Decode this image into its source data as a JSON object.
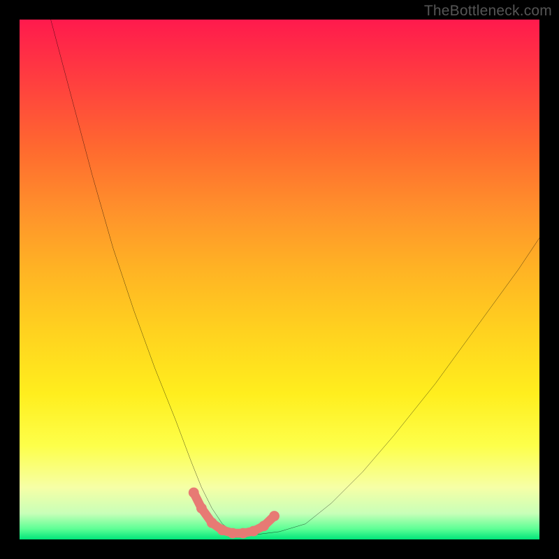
{
  "watermark": "TheBottleneck.com",
  "chart_data": {
    "type": "line",
    "title": "",
    "xlabel": "",
    "ylabel": "",
    "xlim": [
      0,
      100
    ],
    "ylim": [
      0,
      100
    ],
    "grid": false,
    "legend": false,
    "annotations": [],
    "background_gradient": {
      "orientation": "vertical",
      "stops": [
        {
          "pos": 0.0,
          "color": "#ff1a4d"
        },
        {
          "pos": 0.25,
          "color": "#ff6a2f"
        },
        {
          "pos": 0.5,
          "color": "#ffb324"
        },
        {
          "pos": 0.75,
          "color": "#ffee1e"
        },
        {
          "pos": 0.95,
          "color": "#c8ffb8"
        },
        {
          "pos": 1.0,
          "color": "#00e57a"
        }
      ]
    },
    "series": [
      {
        "name": "bottleneck-curve",
        "color": "#000000",
        "stroke_width": 2,
        "x": [
          6,
          10,
          14,
          18,
          22,
          26,
          30,
          33,
          35,
          37,
          39,
          41,
          43,
          46,
          50,
          55,
          60,
          66,
          72,
          80,
          88,
          96,
          100
        ],
        "y": [
          100,
          85,
          70,
          56,
          44,
          33,
          23,
          15,
          10,
          6,
          3,
          1.5,
          1,
          1,
          1.5,
          3,
          7,
          13,
          20,
          30,
          41,
          52,
          58
        ]
      },
      {
        "name": "optimal-band-highlight",
        "color": "#e77a74",
        "stroke_width": 10,
        "x": [
          33.5,
          35,
          37,
          39,
          41,
          43,
          45,
          47,
          49
        ],
        "y": [
          9,
          6,
          3.2,
          1.8,
          1.2,
          1.2,
          1.6,
          2.6,
          4.5
        ]
      }
    ]
  }
}
